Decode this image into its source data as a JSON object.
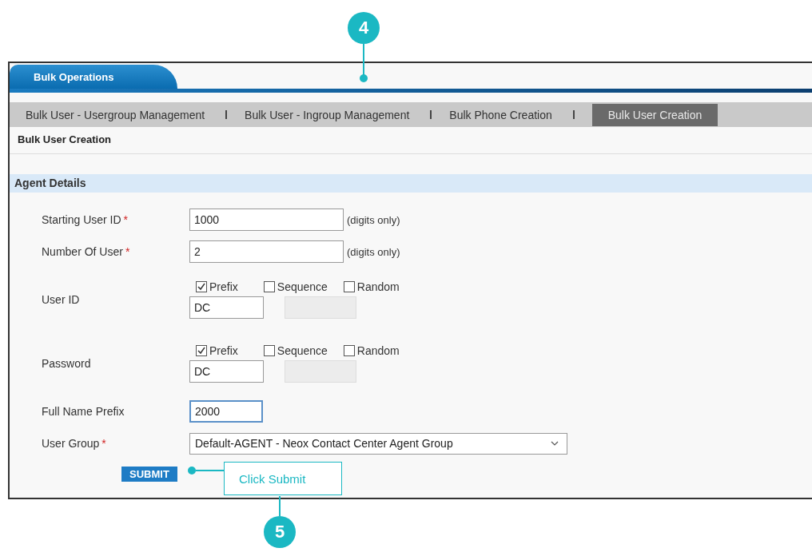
{
  "callouts": [
    {
      "number": "4"
    },
    {
      "number": "5",
      "note": "Click Submit"
    }
  ],
  "main_tab": {
    "label": "Bulk Operations"
  },
  "subnav": [
    {
      "label": "Bulk User - Usergroup Management",
      "selected": false
    },
    {
      "label": "Bulk User - Ingroup Management",
      "selected": false
    },
    {
      "label": "Bulk Phone Creation",
      "selected": false
    },
    {
      "label": "Bulk User Creation",
      "selected": true
    }
  ],
  "page_title": "Bulk User Creation",
  "section": "Agent Details",
  "fields": [
    {
      "kind": "text",
      "label": "Starting User ID",
      "required_mark": "*",
      "value": "1000",
      "hint": "(digits only)",
      "focused": false
    },
    {
      "kind": "text",
      "label": "Number Of User",
      "required_mark": "*",
      "value": "2",
      "hint": "(digits only)",
      "focused": false
    },
    {
      "kind": "options",
      "label": "User ID",
      "options": [
        {
          "label": "Prefix",
          "checked": true
        },
        {
          "label": "Sequence",
          "checked": false
        },
        {
          "label": "Random",
          "checked": false
        }
      ],
      "value": "DC"
    },
    {
      "kind": "options",
      "label": "Password",
      "options": [
        {
          "label": "Prefix",
          "checked": true
        },
        {
          "label": "Sequence",
          "checked": false
        },
        {
          "label": "Random",
          "checked": false
        }
      ],
      "value": "DC"
    },
    {
      "kind": "short",
      "label": "Full Name Prefix",
      "value": "2000",
      "focused": true
    },
    {
      "kind": "select",
      "label": "User Group",
      "required_mark": "*",
      "value": "Default-AGENT - Neox Contact Center Agent Group"
    }
  ],
  "submit": "SUBMIT"
}
